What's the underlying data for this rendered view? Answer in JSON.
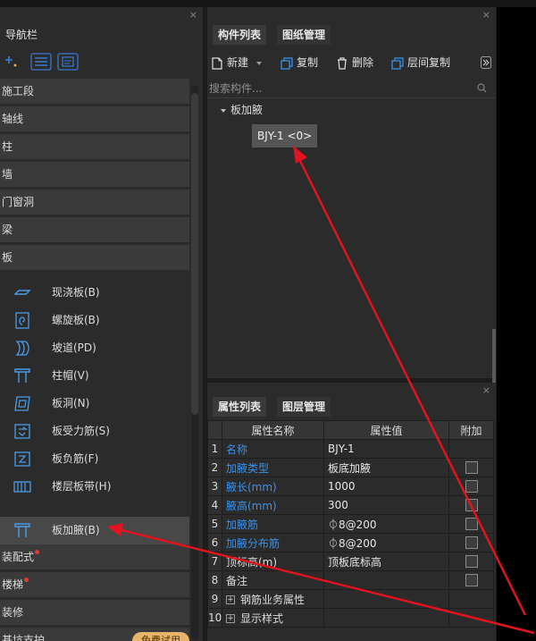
{
  "nav": {
    "title": "导航栏",
    "close_glyph": "×",
    "categories_top": [
      "施工段",
      "轴线",
      "柱",
      "墙",
      "门窗洞",
      "梁",
      "板"
    ],
    "sub_items": [
      "现浇板(B)",
      "螺旋板(B)",
      "坡道(PD)",
      "柱帽(V)",
      "板洞(N)",
      "板受力筋(S)",
      "板负筋(F)",
      "楼层板带(H)",
      "板加腋(B)"
    ],
    "selected_sub": "板加腋(B)",
    "categories_bottom": [
      "装配式",
      "楼梯",
      "装修",
      "基坑支护"
    ],
    "trial_badge": "免费试用",
    "more_row": "基坑支护"
  },
  "components": {
    "tabs": [
      "构件列表",
      "图纸管理"
    ],
    "actions": {
      "new": "新建",
      "copy": "复制",
      "delete": "删除",
      "floor_copy": "层间复制"
    },
    "search_placeholder": "搜索构件...",
    "tree_root": "板加腋",
    "tree_item": "BJY-1 <0>"
  },
  "properties": {
    "tabs": [
      "属性列表",
      "图层管理"
    ],
    "headers": [
      "属性名称",
      "属性值",
      "附加"
    ],
    "rows": [
      {
        "num": "1",
        "name": "名称",
        "value": "BJY-1"
      },
      {
        "num": "2",
        "name": "加腋类型",
        "value": "板底加腋"
      },
      {
        "num": "3",
        "name": "腋长(mm)",
        "value": "1000"
      },
      {
        "num": "4",
        "name": "腋高(mm)",
        "value": "300"
      },
      {
        "num": "5",
        "name": "加腋筋",
        "value": "⏀8@200"
      },
      {
        "num": "6",
        "name": "加腋分布筋",
        "value": "⏀8@200"
      },
      {
        "num": "7",
        "name": "顶标高(m)",
        "value": "顶板底标高"
      },
      {
        "num": "8",
        "name": "备注",
        "value": ""
      },
      {
        "num": "9",
        "name": "钢筋业务属性",
        "value": ""
      },
      {
        "num": "10",
        "name": "显示样式",
        "value": ""
      }
    ]
  },
  "colors": {
    "accent_blue": "#3d8fe6",
    "annotation_red": "#e0141e",
    "panel": "#2b2b2b"
  }
}
